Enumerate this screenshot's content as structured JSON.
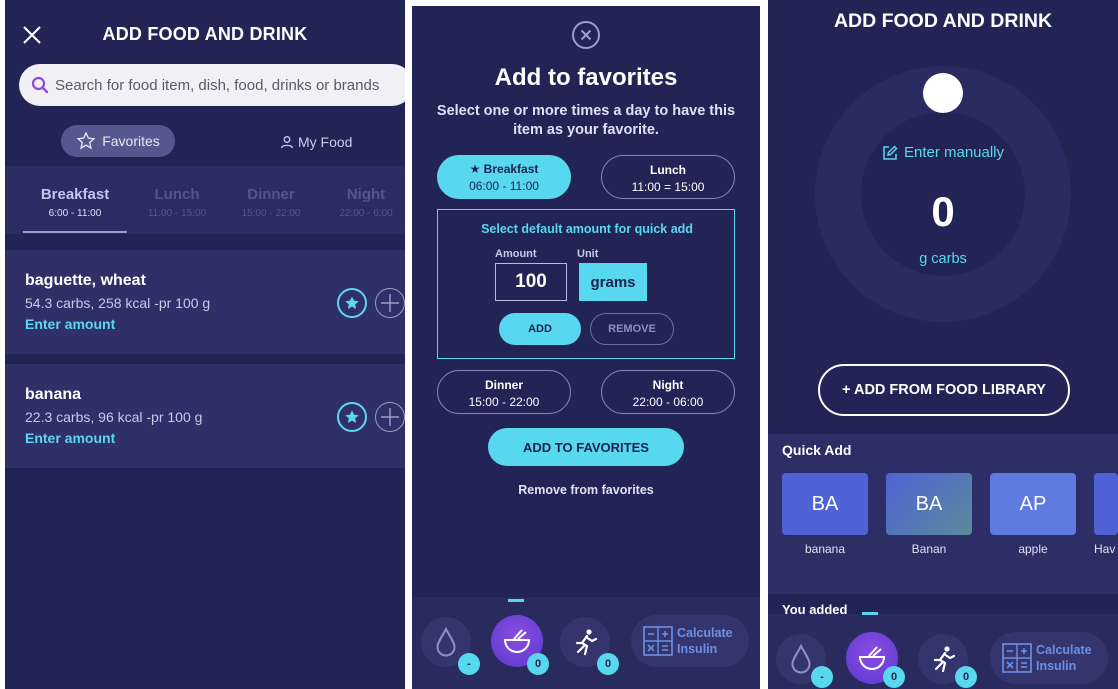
{
  "panel1": {
    "title": "ADD FOOD AND DRINK",
    "search_placeholder": "Search for food item, dish, food, drinks or brands",
    "tab_favorites": "Favorites",
    "tab_my_food": "My Food",
    "meals": [
      {
        "name": "Breakfast",
        "time": "6:00 - 11:00"
      },
      {
        "name": "Lunch",
        "time": "11:00 - 15:00"
      },
      {
        "name": "Dinner",
        "time": "15:00 - 22:00"
      },
      {
        "name": "Night",
        "time": "22:00 - 6:00"
      }
    ],
    "foods": [
      {
        "name": "baguette, wheat",
        "info": "54.3 carbs, 258 kcal -pr 100 g",
        "action": "Enter amount"
      },
      {
        "name": "banana",
        "info": "22.3 carbs, 96 kcal -pr 100 g",
        "action": "Enter amount"
      }
    ]
  },
  "panel2": {
    "title": "Add to favorites",
    "subtitle": "Select one or more times a day to have this item as your favorite.",
    "meals": [
      {
        "name": "★ Breakfast",
        "time": "06:00 - 11:00"
      },
      {
        "name": "Lunch",
        "time": "11:00 = 15:00"
      },
      {
        "name": "Dinner",
        "time": "15:00 - 22:00"
      },
      {
        "name": "Night",
        "time": "22:00 - 06:00"
      }
    ],
    "default_title": "Select default amount for quick add",
    "amount_label": "Amount",
    "unit_label": "Unit",
    "amount_value": "100",
    "unit_value": "grams",
    "add_label": "ADD",
    "remove_label": "REMOVE",
    "add_favorites_label": "ADD TO FAVORITES",
    "remove_favorites_label": "Remove from favorites"
  },
  "nav": {
    "drop_badge": "-",
    "food_badge": "0",
    "run_badge": "0",
    "calc_label_1": "Calculate",
    "calc_label_2": "Insulin"
  },
  "panel3": {
    "title": "ADD FOOD AND DRINK",
    "enter_manually": "Enter manually",
    "value": "0",
    "unit": "g carbs",
    "library_button": "+ ADD FROM FOOD LIBRARY",
    "quick_add_title": "Quick Add",
    "quick_items": [
      {
        "abbr": "BA",
        "label": "banana",
        "color": "#4f63d6"
      },
      {
        "abbr": "BA",
        "label": "Banan",
        "color": "#5a6ec6"
      },
      {
        "abbr": "AP",
        "label": "apple",
        "color": "#5f7ae0"
      },
      {
        "abbr": "",
        "label": "Hav",
        "color": "#4f63d6"
      }
    ],
    "you_added": "You added"
  },
  "colors": {
    "background": "#232456",
    "accent": "#58d8ee",
    "card": "#2e3067"
  }
}
